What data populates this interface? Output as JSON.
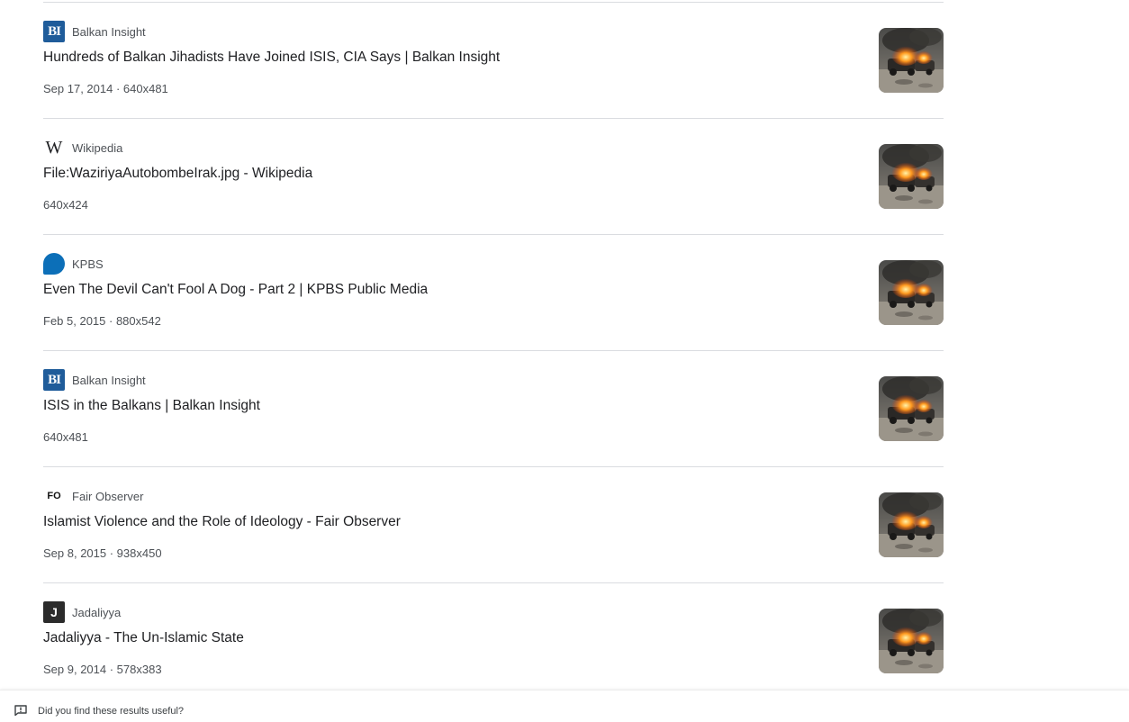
{
  "results": [
    {
      "source": "Balkan Insight",
      "favicon": "balkan-insight-logo",
      "title": "Hundreds of Balkan Jihadists Have Joined ISIS, CIA Says | Balkan Insight",
      "meta": "Sep 17, 2014 · 640x481"
    },
    {
      "source": "Wikipedia",
      "favicon": "wikipedia-logo",
      "title": "File:WaziriyaAutobombeIrak.jpg - Wikipedia",
      "meta": "640x424"
    },
    {
      "source": "KPBS",
      "favicon": "kpbs-logo",
      "title": "Even The Devil Can't Fool A Dog - Part 2 | KPBS Public Media",
      "meta": "Feb 5, 2015 · 880x542"
    },
    {
      "source": "Balkan Insight",
      "favicon": "balkan-insight-logo",
      "title": "ISIS in the Balkans | Balkan Insight",
      "meta": "640x481"
    },
    {
      "source": "Fair Observer",
      "favicon": "fair-observer-logo",
      "title": "Islamist Violence and the Role of Ideology - Fair Observer",
      "meta": "Sep 8, 2015 · 938x450"
    },
    {
      "source": "Jadaliyya",
      "favicon": "jadaliyya-logo",
      "title": "Jadaliyya - The Un-Islamic State",
      "meta": "Sep 9, 2014 · 578x383"
    }
  ],
  "favicon_text": {
    "bi": "BI",
    "w": "W",
    "fo": "FO",
    "j": "J"
  },
  "feedback": {
    "text": "Did you find these results useful?",
    "icon": "feedback-icon"
  },
  "colors": {
    "title": "#202124",
    "secondary": "#4d5156",
    "divider": "#dadce0"
  }
}
